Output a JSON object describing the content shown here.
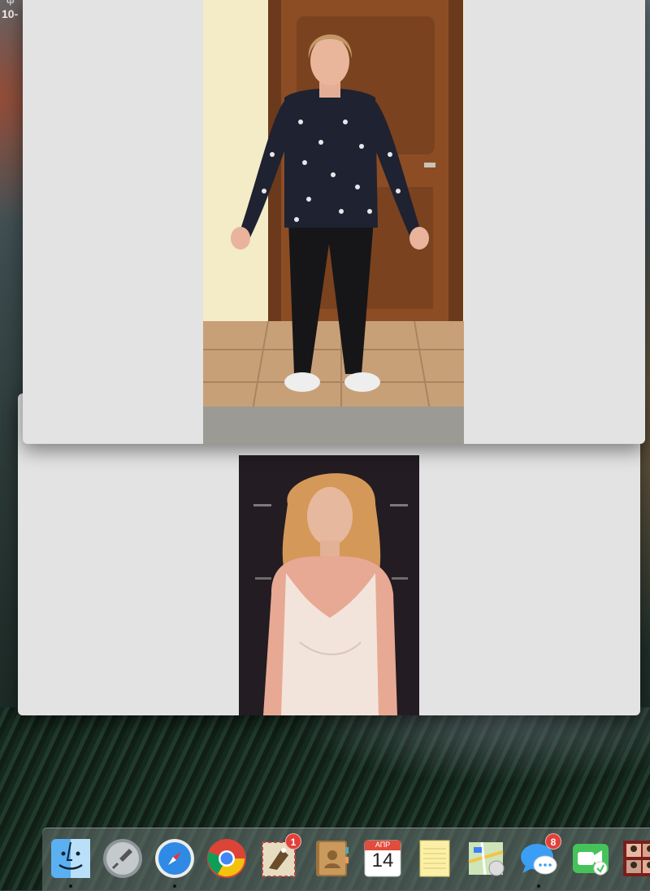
{
  "menubar": {
    "time_fragment": "10-"
  },
  "windows": [
    {
      "name": "front-photo-window",
      "photo": "woman in dark patterned blouse and black trousers standing by wooden door"
    },
    {
      "name": "back-photo-window",
      "photo": "woman with curly blonde hair in light lace camisole"
    }
  ],
  "dock": {
    "items": [
      {
        "id": "finder",
        "icon": "finder-icon",
        "running": true
      },
      {
        "id": "launchpad",
        "icon": "launchpad-rocket-icon",
        "running": false
      },
      {
        "id": "safari",
        "icon": "safari-compass-icon",
        "running": true
      },
      {
        "id": "chrome",
        "icon": "chrome-icon",
        "running": false
      },
      {
        "id": "mail",
        "icon": "mail-eagle-icon",
        "running": false,
        "badge": "1"
      },
      {
        "id": "contacts",
        "icon": "contacts-book-icon",
        "running": false
      },
      {
        "id": "calendar",
        "icon": "calendar-icon",
        "running": false,
        "month": "АПР",
        "day": "14"
      },
      {
        "id": "notes",
        "icon": "notes-icon",
        "running": false
      },
      {
        "id": "maps",
        "icon": "maps-icon",
        "running": false
      },
      {
        "id": "messages",
        "icon": "messages-bubble-icon",
        "running": true,
        "badge": "8"
      },
      {
        "id": "facetime",
        "icon": "facetime-camera-icon",
        "running": false
      },
      {
        "id": "photo-booth",
        "icon": "photo-booth-icon",
        "running": false
      }
    ]
  },
  "colors": {
    "window_bg": "#e3e3e3",
    "badge": "#e0413a",
    "dock_bg": "rgba(110,120,118,0.55)"
  }
}
